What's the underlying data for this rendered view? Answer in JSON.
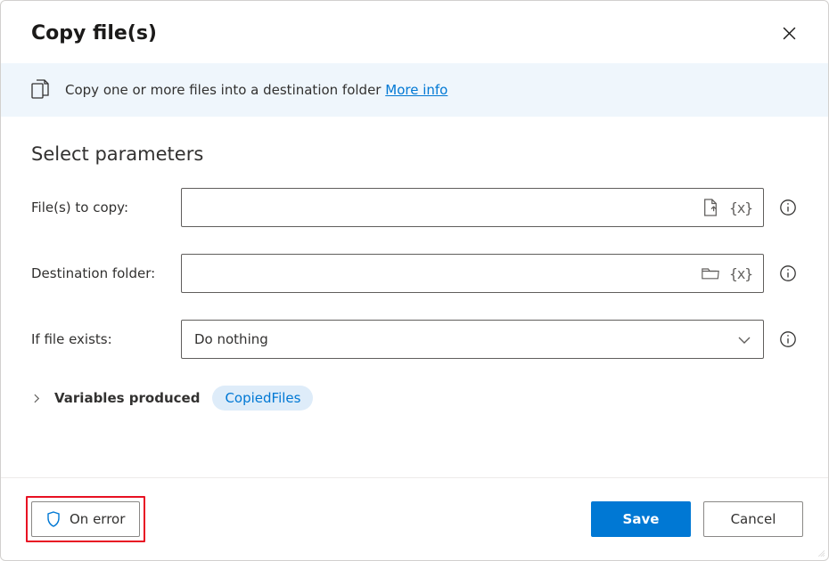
{
  "dialog": {
    "title": "Copy file(s)",
    "info_text": "Copy one or more files into a destination folder ",
    "more_info_label": "More info"
  },
  "section_title": "Select parameters",
  "params": {
    "files_to_copy": {
      "label": "File(s) to copy:",
      "value": ""
    },
    "destination": {
      "label": "Destination folder:",
      "value": ""
    },
    "if_exists": {
      "label": "If file exists:",
      "selected": "Do nothing"
    }
  },
  "icons": {
    "variable_glyph": "{x}"
  },
  "variables_produced": {
    "label": "Variables produced",
    "items": [
      "CopiedFiles"
    ]
  },
  "footer": {
    "on_error_label": "On error",
    "save_label": "Save",
    "cancel_label": "Cancel"
  }
}
